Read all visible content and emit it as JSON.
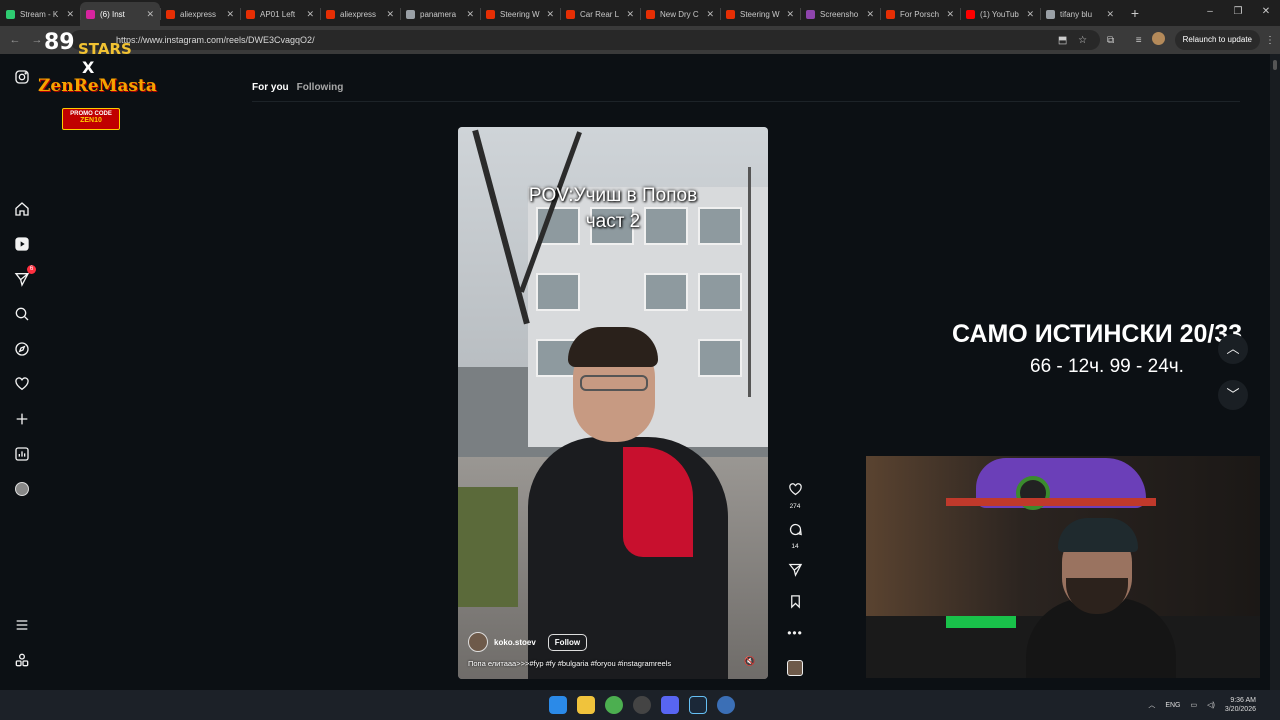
{
  "browser": {
    "tabs": [
      {
        "label": "Stream - K",
        "color": "#2ecc71"
      },
      {
        "label": "(6) Inst",
        "color": "#d6249f",
        "active": true
      },
      {
        "label": "aliexpress",
        "color": "#e62e04"
      },
      {
        "label": "AP01 Left",
        "color": "#e62e04"
      },
      {
        "label": "aliexpress",
        "color": "#e62e04"
      },
      {
        "label": "panamera",
        "color": "#9aa0a6"
      },
      {
        "label": "Steering W",
        "color": "#e62e04"
      },
      {
        "label": "Car Rear L",
        "color": "#e62e04"
      },
      {
        "label": "New Dry C",
        "color": "#e62e04"
      },
      {
        "label": "Steering W",
        "color": "#e62e04"
      },
      {
        "label": "Screensho",
        "color": "#8e44ad"
      },
      {
        "label": "For Porsch",
        "color": "#e62e04"
      },
      {
        "label": "(1) YouTub",
        "color": "#ff0000"
      },
      {
        "label": "tifany blu",
        "color": "#9aa0a6"
      }
    ],
    "new_tab_glyph": "+",
    "close_glyph": "✕",
    "url": "https://www.instagram.com/reels/DWE3CvagqO2/",
    "relaunch_label": "Relaunch to update",
    "window_controls": [
      "–",
      "❐",
      "✕"
    ]
  },
  "stream_logo": {
    "number": "89",
    "stars": "STARS",
    "x": "X",
    "brand": "ZenReMasta",
    "promo_label": "PROMO CODE",
    "promo_code": "ZEN10"
  },
  "feed": {
    "tab_for_you": "For you",
    "tab_following": "Following"
  },
  "nav": {
    "messages_badge": "6"
  },
  "reel": {
    "caption_line1": "POV:Учиш в Попов",
    "caption_line2": "част 2",
    "author": "koko.stoev",
    "follow_label": "Follow",
    "description": "Попа елитааа>>>#fyp #fy #bulgaria #foryou #instagramreels",
    "likes": "274",
    "comments": "14",
    "more_glyph": "•••",
    "mute_glyph": "🔇"
  },
  "overlay": {
    "title": "САМО ИСТИНСКИ 20/33",
    "subtitle": "66 - 12ч.  99 - 24ч."
  },
  "taskbar": {
    "lang": "ENG",
    "time": "9:36 AM",
    "date": "3/20/2026"
  },
  "colors": {
    "ig_bg": "#0c1014",
    "accent_red": "#c8102e"
  }
}
